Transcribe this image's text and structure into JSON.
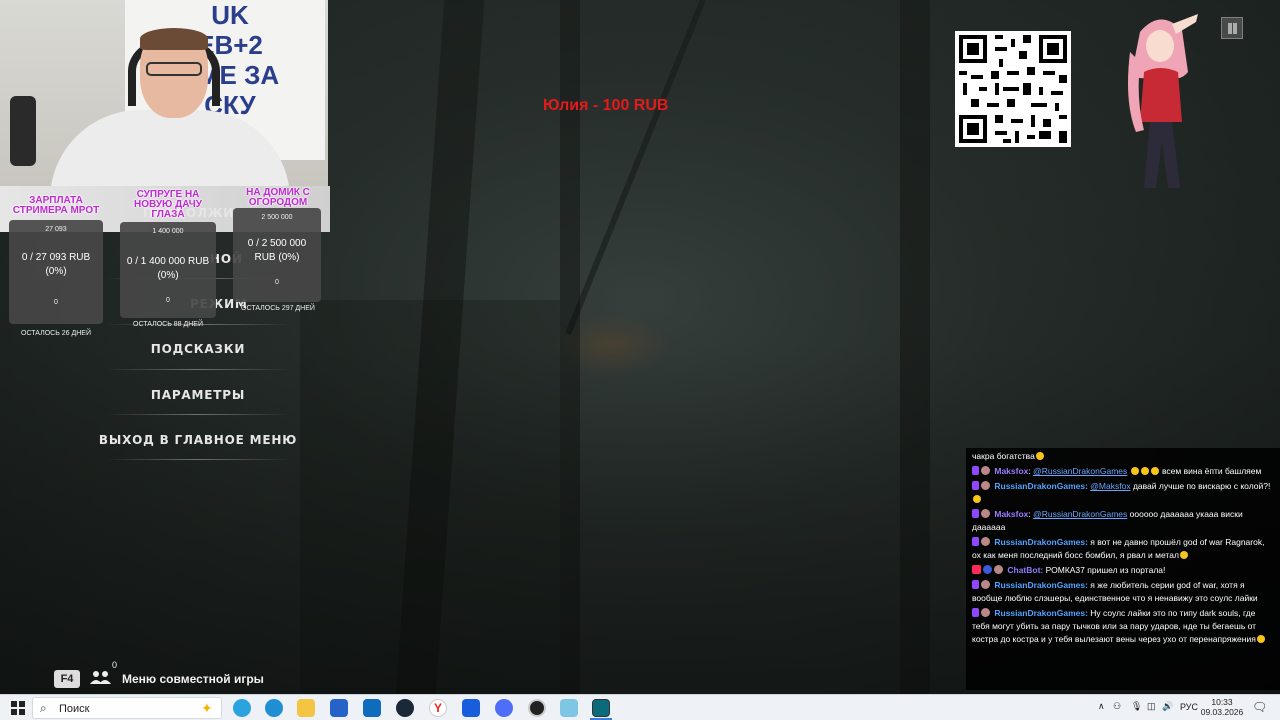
{
  "game": {
    "menu": [
      {
        "label": "ПРОДОЛЖИТЬ"
      },
      {
        "label": "НОЙ"
      },
      {
        "label": "РЕЖИМ"
      },
      {
        "label": "ПОДСКАЗКИ"
      },
      {
        "label": "ПАРАМЕТРЫ"
      },
      {
        "label": "ВЫХОД В ГЛАВНОЕ МЕНЮ"
      }
    ],
    "hint": {
      "key": "F4",
      "count": "0",
      "label": "Меню совместной игры"
    }
  },
  "overlay": {
    "donation_alert": "Юлия - 100 RUB",
    "webcam_poster": "UK\nЕВ+2\nРМЕ ЗА\nСКУ\nАТ",
    "goals": [
      {
        "title": "ЗАРПЛАТА СТРИМЕРА МРОТ",
        "target": "27 093",
        "progress": "0 / 27 093 RUB (0%)",
        "current": "0",
        "remaining": "ОСТАЛОСЬ 26 ДНЕЙ",
        "fraction": 0
      },
      {
        "title": "СУПРУГЕ НА НОВУЮ ДАЧУ ГЛАЗА",
        "target": "1 400 000",
        "progress": "0 / 1 400 000 RUB (0%)",
        "current": "0",
        "remaining": "ОСТАЛОСЬ 88 ДНЕЙ",
        "fraction": 0
      },
      {
        "title": "НА ДОМИК С ОГОРОДОМ",
        "target": "2 500 000",
        "progress": "0 / 2 500 000 RUB (0%)",
        "current": "0",
        "remaining": "ОСТАЛОСЬ 297 ДНЕЙ",
        "fraction": 0
      }
    ]
  },
  "chat": {
    "messages": [
      {
        "icons": [],
        "user": "",
        "text": "чакра богатства"
      },
      {
        "icons": [
          "twitch",
          "avatar"
        ],
        "user": "Maksfox",
        "mention": "@RussianDrakonGames",
        "text": "всем вина ёпти башляем"
      },
      {
        "icons": [
          "twitch",
          "avatar"
        ],
        "user": "RussianDrakonGames:",
        "mention": "@Maksfox",
        "text": "давай лучше по вискарю с колой?!"
      },
      {
        "icons": [
          "twitch",
          "avatar"
        ],
        "user": "Maksfox",
        "mention": "@RussianDrakonGames",
        "text": "оооооо дааааaa укааа виски даааааа"
      },
      {
        "icons": [
          "twitch",
          "avatar"
        ],
        "user": "RussianDrakonGames:",
        "mention": "",
        "text": "я вот не давно прошёл god of war Ragnarok, ох как меня последний босс бомбил, я рвал и метал"
      },
      {
        "icons": [
          "youtube",
          "bot",
          "avatar"
        ],
        "user": "ChatBot:",
        "mention": "",
        "text": "РОМКА37 пришел из портала!"
      },
      {
        "icons": [
          "twitch",
          "avatar"
        ],
        "user": "RussianDrakonGames:",
        "mention": "",
        "text": "я же любитель серии god of war, хотя я вообще люблю слэшеры, единственное что я ненавижу это соулс лайки"
      },
      {
        "icons": [
          "twitch",
          "avatar"
        ],
        "user": "RussianDrakonGames:",
        "mention": "",
        "text": "Ну соулс лайки это по типу dark souls, где тебя могут убить за пару тычков или за пару ударов, нде ты бегаешь от костра до костра и у тебя вылезают вены через ухо от перенапряжения"
      }
    ]
  },
  "taskbar": {
    "search_placeholder": "Поиск",
    "language": "РУС",
    "time": "10:33",
    "date": "09.03.2026"
  }
}
